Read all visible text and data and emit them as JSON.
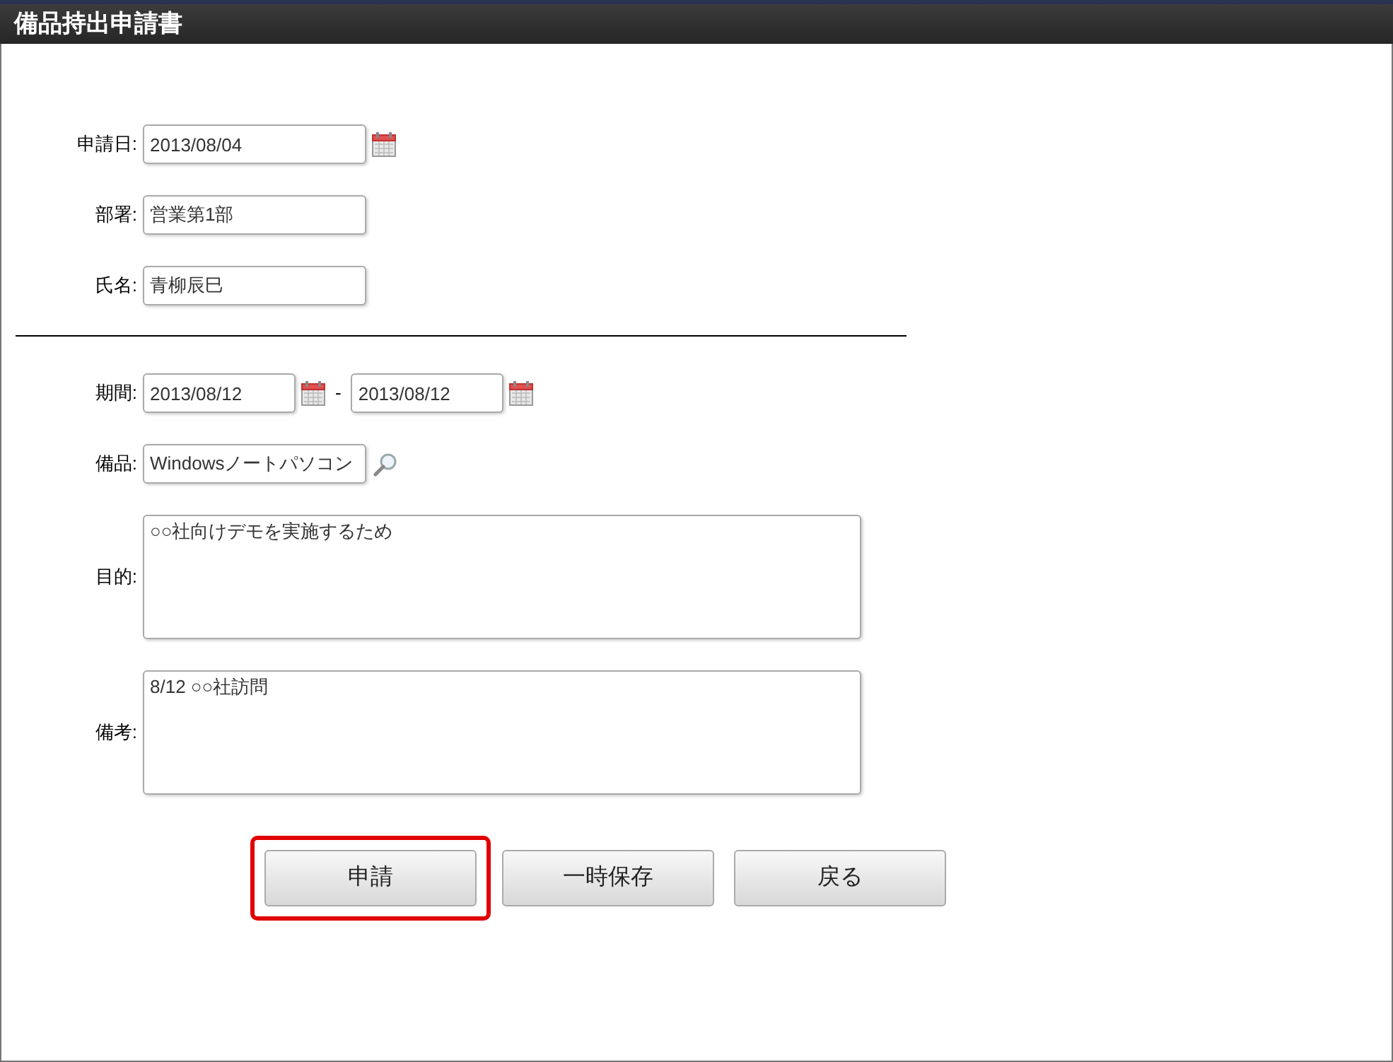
{
  "window": {
    "title": "備品持出申請書"
  },
  "applicant_fields": [
    {
      "kind": "date",
      "label": "申請日:",
      "value": "2013/08/04"
    },
    {
      "kind": "text",
      "label": "部署:",
      "value": "営業第1部"
    },
    {
      "kind": "text",
      "label": "氏名:",
      "value": "青柳辰巳"
    }
  ],
  "request_fields": [
    {
      "kind": "date_range",
      "label": "期間:",
      "value": "2013/08/12",
      "separator": "-",
      "value_end": "2013/08/12"
    },
    {
      "kind": "lookup",
      "label": "備品:",
      "value": "Windowsノートパソコン"
    },
    {
      "kind": "textarea",
      "label": "目的:",
      "value": "○○社向けデモを実施するため"
    },
    {
      "kind": "textarea",
      "label": "備考:",
      "value": "8/12 ○○社訪問"
    }
  ],
  "buttons": [
    {
      "label": "申請",
      "highlighted": true
    },
    {
      "label": "一時保存",
      "highlighted": false
    },
    {
      "label": "戻る",
      "highlighted": false
    }
  ]
}
